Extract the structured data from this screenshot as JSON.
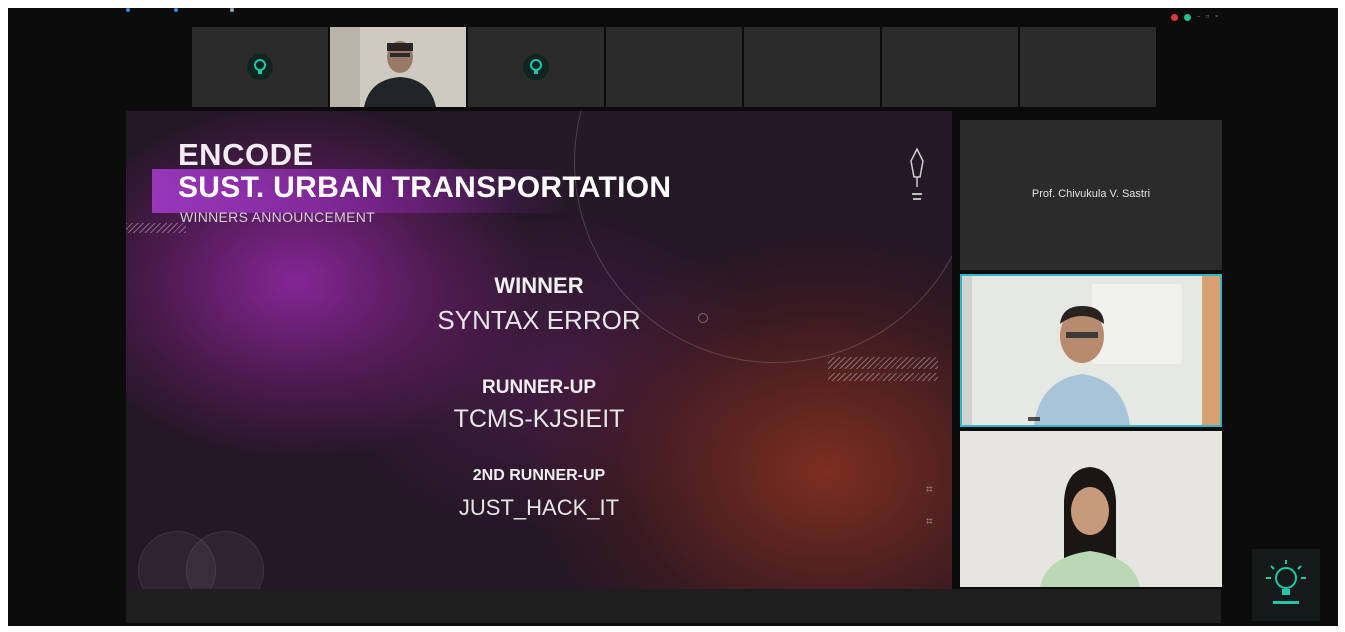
{
  "slide": {
    "title": "ENCODE",
    "subtitle": "SUST. URBAN TRANSPORTATION",
    "announcement": "WINNERS ANNOUNCEMENT",
    "results": [
      {
        "heading": "WINNER",
        "team": "SYNTAX ERROR"
      },
      {
        "heading": "RUNNER-UP",
        "team": "TCMS-KJSIEIT"
      },
      {
        "heading": "2ND RUNNER-UP",
        "team": "JUST_HACK_IT"
      }
    ]
  },
  "side_panel": {
    "host_name": "Prof. Chivukula V. Sastri"
  },
  "colors": {
    "speaker_highlight": "#2fb6c9",
    "recording": "#e0353a",
    "secure": "#1ec28b",
    "brand": "#1ec8a6"
  },
  "icons": [
    "brand-logo-icon",
    "recording-icon",
    "security-icon",
    "minimize-icon",
    "maximize-icon",
    "close-icon",
    "gallery-grid-icon"
  ]
}
